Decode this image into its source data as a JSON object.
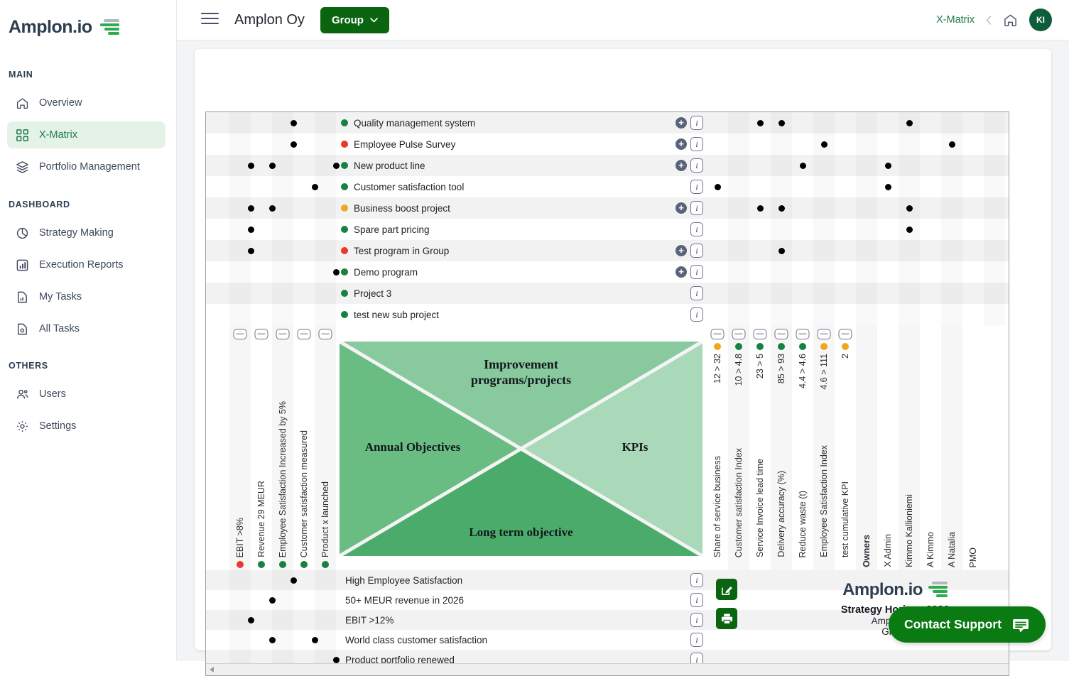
{
  "brand": {
    "name": "Amplon.io",
    "logo_icon": "amplon-logo-icon"
  },
  "sidebar": {
    "sections": [
      {
        "label": "MAIN",
        "items": [
          {
            "label": "Overview",
            "icon": "home-icon",
            "active": false
          },
          {
            "label": "X-Matrix",
            "icon": "grid-icon",
            "active": true
          },
          {
            "label": "Portfolio Management",
            "icon": "layers-icon",
            "active": false
          }
        ]
      },
      {
        "label": "DASHBOARD",
        "items": [
          {
            "label": "Strategy Making",
            "icon": "pie-chart-icon",
            "active": false
          },
          {
            "label": "Execution Reports",
            "icon": "bar-chart-icon",
            "active": false
          },
          {
            "label": "My Tasks",
            "icon": "document-chart-icon",
            "active": false
          },
          {
            "label": "All Tasks",
            "icon": "document-search-icon",
            "active": false
          }
        ]
      },
      {
        "label": "OTHERS",
        "items": [
          {
            "label": "Users",
            "icon": "users-icon",
            "active": false
          },
          {
            "label": "Settings",
            "icon": "gear-icon",
            "active": false
          }
        ]
      }
    ]
  },
  "topbar": {
    "menu_icon": "hamburger-icon",
    "org_title": "Amplon Oy",
    "group_button": {
      "label": "Group",
      "icon": "chevron-down-icon"
    },
    "breadcrumb_link": "X-Matrix",
    "back_icon": "chevron-left-icon",
    "home_icon": "home-icon",
    "avatar_initials": "KI"
  },
  "colors": {
    "accent_green": "#0a6410",
    "status_green": "#17813f",
    "status_amber": "#efa81e",
    "status_red": "#e8392b",
    "sidebar_active_bg": "#e4f2e8"
  },
  "xdiagram": {
    "top": "Improvement\nprograms/projects",
    "left": "Annual Objectives",
    "right": "KPIs",
    "bottom": "Long term objective"
  },
  "chart_data": {
    "type": "table",
    "title": "X-Matrix - Strategy Horizon 2026",
    "annual_objectives": [
      {
        "label": "EBIT >8%",
        "status": "red"
      },
      {
        "label": "Revenue 29 MEUR",
        "status": "green"
      },
      {
        "label": "Employee Satisfaction Increased by 5%",
        "status": "green"
      },
      {
        "label": "Customer satisfaction measured",
        "status": "green"
      },
      {
        "label": "Product x launched",
        "status": "green"
      }
    ],
    "kpis": [
      {
        "label": "Share of service business",
        "value": "12 > 32",
        "status": "amber"
      },
      {
        "label": "Customer satisfaction Index",
        "value": "10 > 4.8",
        "status": "green"
      },
      {
        "label": "Service Invoice lead time",
        "value": "23 > 5",
        "status": "green"
      },
      {
        "label": "Delivery accuracy (%)",
        "value": "85 > 93",
        "status": "green"
      },
      {
        "label": "Reduce waste (t)",
        "value": "4.4 > 4.6",
        "status": "green"
      },
      {
        "label": "Employee Satisfaction Index",
        "value": "4.6 > 111",
        "status": "amber"
      },
      {
        "label": "test cumulative KPI",
        "value": "2",
        "status": "amber"
      }
    ],
    "owners_header": "Owners",
    "owners": [
      "X Admin",
      "Kimmo Kallioniemi",
      "A Kimmo",
      "A Natalia",
      "PMO"
    ],
    "programs": [
      {
        "label": "Quality management system",
        "status": "green",
        "has_add": true,
        "obj_dots": [
          3
        ],
        "kpi_dots": [
          2,
          3
        ],
        "owner_dots": [
          1
        ]
      },
      {
        "label": "Employee Pulse Survey",
        "status": "red",
        "has_add": true,
        "obj_dots": [
          3
        ],
        "kpi_dots": [
          5
        ],
        "owner_dots": [
          3
        ]
      },
      {
        "label": "New product line",
        "status": "green",
        "has_add": true,
        "obj_dots": [
          1,
          2,
          5
        ],
        "kpi_dots": [
          4
        ],
        "owner_dots": [
          0
        ]
      },
      {
        "label": "Customer satisfaction tool",
        "status": "green",
        "has_add": false,
        "obj_dots": [
          4
        ],
        "kpi_dots": [
          0
        ],
        "owner_dots": [
          0
        ]
      },
      {
        "label": "Business boost project",
        "status": "amber",
        "has_add": true,
        "obj_dots": [
          1,
          2
        ],
        "kpi_dots": [
          2,
          3
        ],
        "owner_dots": [
          1
        ]
      },
      {
        "label": "Spare part pricing",
        "status": "green",
        "has_add": false,
        "obj_dots": [
          1
        ],
        "kpi_dots": [],
        "owner_dots": [
          1
        ]
      },
      {
        "label": "Test program in Group",
        "status": "red",
        "has_add": true,
        "obj_dots": [
          1
        ],
        "kpi_dots": [
          3
        ],
        "owner_dots": []
      },
      {
        "label": "Demo program",
        "status": "green",
        "has_add": true,
        "obj_dots": [
          5
        ],
        "kpi_dots": [],
        "owner_dots": []
      },
      {
        "label": "Project 3",
        "status": "green",
        "has_add": false,
        "obj_dots": [],
        "kpi_dots": [],
        "owner_dots": []
      },
      {
        "label": "test new sub project",
        "status": "green",
        "has_add": false,
        "obj_dots": [],
        "kpi_dots": [],
        "owner_dots": []
      }
    ],
    "long_term_objectives": [
      {
        "label": "High Employee Satisfaction",
        "obj_dots": [
          3
        ]
      },
      {
        "label": "50+ MEUR revenue in 2026",
        "obj_dots": [
          2
        ]
      },
      {
        "label": "EBIT >12%",
        "obj_dots": [
          1
        ]
      },
      {
        "label": "World class customer satisfaction",
        "obj_dots": [
          2,
          4
        ]
      },
      {
        "label": "Product portfolio renewed",
        "obj_dots": [
          5
        ]
      }
    ]
  },
  "actions": {
    "edit_icon": "edit-pencil-icon",
    "print_icon": "printer-icon"
  },
  "footer": {
    "logo_text": "Amplon.io",
    "title": "Strategy Horizon 2026",
    "sub1": "Amplon Oy",
    "sub2": "Group"
  },
  "contact_support": {
    "label": "Contact Support",
    "icon": "chat-icon"
  },
  "scrollbar": {
    "left_arrow_icon": "triangle-left-icon"
  }
}
